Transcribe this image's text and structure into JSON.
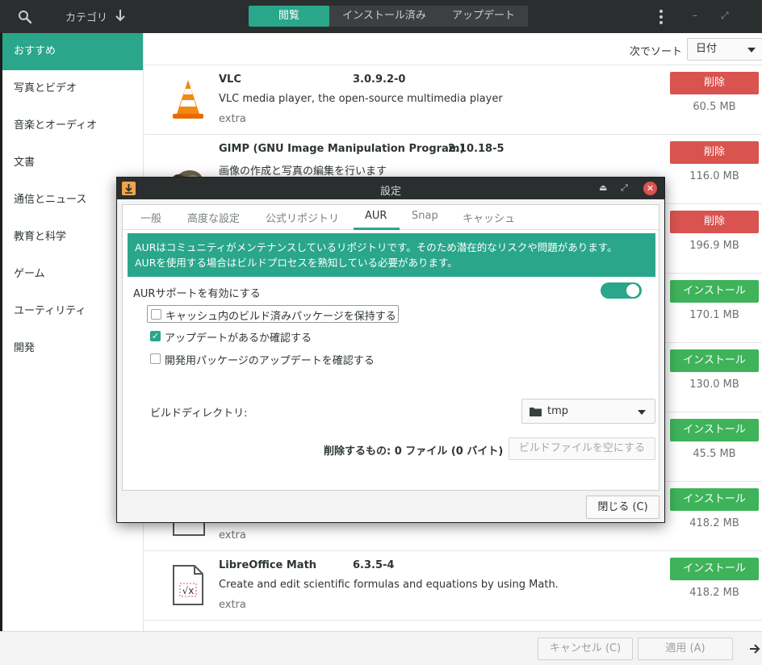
{
  "header": {
    "category_label": "カテゴリ",
    "tabs": [
      {
        "label": "閲覧"
      },
      {
        "label": "インストール済み"
      },
      {
        "label": "アップデート"
      }
    ],
    "minimize": "–",
    "maximize": "⤢"
  },
  "sidebar": {
    "items": [
      {
        "label": "おすすめ"
      },
      {
        "label": "写真とビデオ"
      },
      {
        "label": "音楽とオーディオ"
      },
      {
        "label": "文書"
      },
      {
        "label": "通信とニュース"
      },
      {
        "label": "教育と科学"
      },
      {
        "label": "ゲーム"
      },
      {
        "label": "ユーティリティ"
      },
      {
        "label": "開発"
      }
    ]
  },
  "sort": {
    "label": "次でソート",
    "value": "日付"
  },
  "packages": [
    {
      "name": "VLC",
      "version": "3.0.9.2-0",
      "description": "VLC media player, the open-source multimedia player",
      "repo": "extra",
      "action": "削除",
      "size": "60.5 MB"
    },
    {
      "name": "GIMP (GNU Image Manipulation Program)",
      "version": "2.10.18-5",
      "description": "画像の作成と写真の編集を行います",
      "repo": "",
      "action": "削除",
      "size": "116.0 MB"
    },
    {
      "name": "",
      "version": "",
      "description": "",
      "repo": "",
      "action": "削除",
      "size": "196.9 MB"
    },
    {
      "name": "",
      "version": "",
      "description": "",
      "repo": "",
      "action": "インストール",
      "size": "170.1 MB"
    },
    {
      "name": "",
      "version": "",
      "description": "",
      "repo": "",
      "action": "インストール",
      "size": "130.0 MB"
    },
    {
      "name": "",
      "version": "",
      "description": "",
      "repo": "",
      "action": "インストール",
      "size": "45.5 MB"
    },
    {
      "name": "",
      "version": "",
      "description": "",
      "repo": "extra",
      "action": "インストール",
      "size": "418.2 MB"
    },
    {
      "name": "LibreOffice Math",
      "version": "6.3.5-4",
      "description": "Create and edit scientific formulas and equations by using Math.",
      "repo": "extra",
      "action": "インストール",
      "size": "418.2 MB"
    }
  ],
  "bottom": {
    "cancel": "キャンセル (C)",
    "apply": "適用 (A)"
  },
  "dialog": {
    "title": "設定",
    "tabs": [
      {
        "label": "一般"
      },
      {
        "label": "高度な設定"
      },
      {
        "label": "公式リポジトリ"
      },
      {
        "label": "AUR"
      },
      {
        "label": "Snap"
      },
      {
        "label": "キャッシュ"
      }
    ],
    "banner_line1": "AURはコミュニティがメンテナンスしているリポジトリです。そのため潜在的なリスクや問題があります。",
    "banner_line2": "AURを使用する場合はビルドプロセスを熟知している必要があります。",
    "aur_toggle_label": "AURサポートを有効にする",
    "aur_enabled": true,
    "options": [
      {
        "label": "キャッシュ内のビルド済みパッケージを保持する",
        "checked": false
      },
      {
        "label": "アップデートがあるか確認する",
        "checked": true
      },
      {
        "label": "開発用パッケージのアップデートを確認する",
        "checked": false
      }
    ],
    "build_dir_label": "ビルドディレクトリ:",
    "build_dir_value": "tmp",
    "delete_label": "削除するもの: 0 ファイル (0 バイト)",
    "delete_button": "ビルドファイルを空にする",
    "close_button": "閉じる (C)"
  },
  "colors": {
    "accent": "#2aa68a",
    "remove": "#d9534f",
    "install": "#3eb35a",
    "headerbar": "#2b2e2f"
  }
}
